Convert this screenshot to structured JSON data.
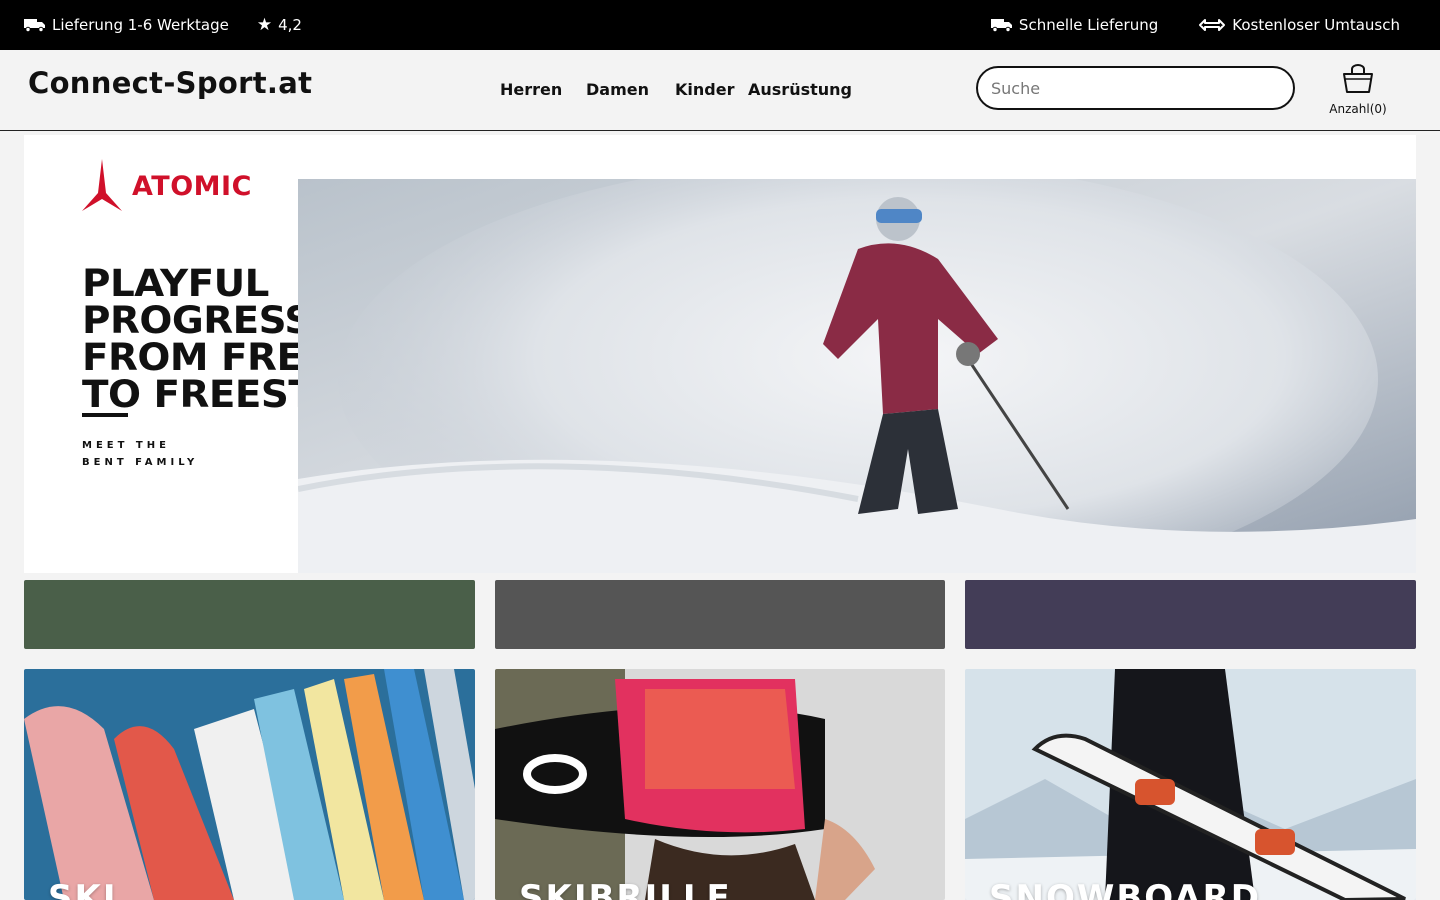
{
  "topbar": {
    "delivery": "Lieferung 1-6 Werktage",
    "rating": "4,2",
    "fast": "Schnelle Lieferung",
    "exchange": "Kostenloser Umtausch"
  },
  "header": {
    "logo": "Connect-Sport.at",
    "nav": [
      "Herren",
      "Damen",
      "Kinder",
      "Ausrüstung"
    ],
    "search_placeholder": "Suche",
    "cart_label": "Anzahl(0)"
  },
  "hero": {
    "brand": "ATOMIC",
    "headline": [
      "PLAYFUL",
      "PROGRESSION",
      "FROM FREERIDE",
      "TO FREESTYLE"
    ],
    "sub": [
      "MEET THE",
      "BENT FAMILY"
    ]
  },
  "strips": [
    {
      "color": "#4a5f49"
    },
    {
      "color": "#555555"
    },
    {
      "color": "#433d57"
    }
  ],
  "categories": [
    {
      "title": "SKI"
    },
    {
      "title": "SKIBRILLE"
    },
    {
      "title": "SNOWBOARD"
    }
  ],
  "colors": {
    "topbar": "#000000",
    "accent": "#d0102a"
  }
}
